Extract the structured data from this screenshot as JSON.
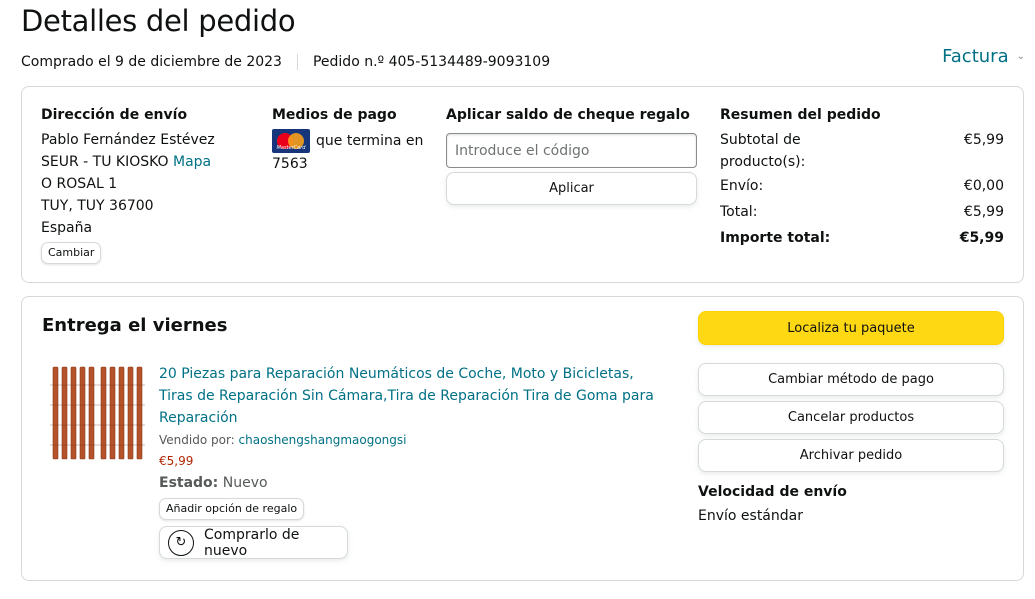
{
  "page": {
    "title": "Detalles del pedido",
    "purchased": "Comprado el 9 de diciembre de 2023",
    "order_number": "Pedido n.º 405-5134489-9093109",
    "invoice_label": "Factura"
  },
  "shipping": {
    "heading": "Dirección de envío",
    "name": "Pablo Fernández Estévez",
    "line1": "SEUR - TU KIOSKO",
    "map_link": "Mapa",
    "line2": "O ROSAL 1",
    "line3": "TUY, TUY 36700",
    "country": "España",
    "change_label": "Cambiar"
  },
  "payment": {
    "heading": "Medios de pago",
    "card_text": "que termina en",
    "card_last": "7563",
    "card_brand_text": "MasterCard",
    "card_icon": "mastercard-icon"
  },
  "gift": {
    "heading": "Aplicar saldo de cheque regalo",
    "placeholder": "Introduce el código",
    "apply_label": "Aplicar"
  },
  "summary": {
    "heading": "Resumen del pedido",
    "rows": [
      {
        "label": "Subtotal de producto(s):",
        "value": "€5,99"
      },
      {
        "label": "Envío:",
        "value": "€0,00"
      },
      {
        "label": "Total:",
        "value": "€5,99"
      },
      {
        "label": "Importe total:",
        "value": "€5,99"
      }
    ]
  },
  "delivery": {
    "title": "Entrega el viernes",
    "product": {
      "title": "20 Piezas para Reparación Neumáticos de Coche, Moto y Bicicletas, Tiras de Reparación Sin Cámara,Tira de Reparación Tira de Goma para Reparación",
      "sold_by_label": "Vendido por:",
      "seller": "chaoshengshangmaogongsi",
      "price": "€5,99",
      "state_label": "Estado:",
      "state_value": "Nuevo",
      "gift_option_label": "Añadir opción de regalo",
      "rebuy_label": "Comprarlo de nuevo",
      "rebuy_icon": "buy-again-icon"
    },
    "actions": {
      "track": "Localiza tu paquete",
      "change_payment": "Cambiar método de pago",
      "cancel": "Cancelar productos",
      "archive": "Archivar pedido"
    },
    "speed_heading": "Velocidad de envío",
    "speed_value": "Envío estándar"
  },
  "colors": {
    "link": "#007185",
    "price": "#b12704",
    "primary_button": "#ffd814",
    "border": "#d5d9d9"
  }
}
